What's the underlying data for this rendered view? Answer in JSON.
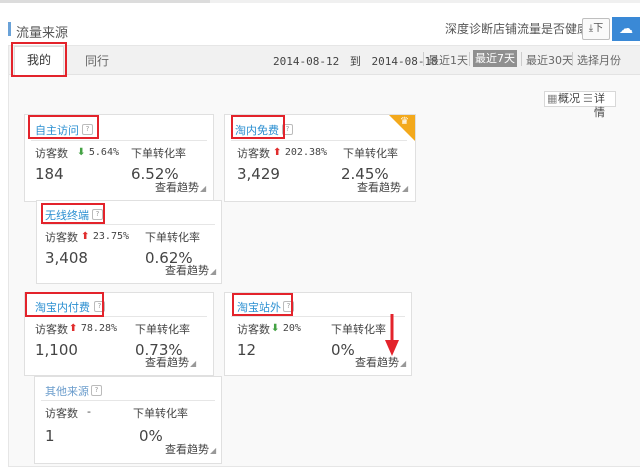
{
  "header": {
    "section_title": "流量来源",
    "health_link": "深度诊断店铺流量是否健康>>",
    "download_icon": "download-icon",
    "download_text": "下"
  },
  "tabs": [
    {
      "label": "我的",
      "active": true
    },
    {
      "label": "同行",
      "active": false
    }
  ],
  "date": {
    "from": "2014-08-12",
    "to_word": "到",
    "to": "2014-08-18"
  },
  "ranges": {
    "day1": "最近1天",
    "day7": "最近7天",
    "day30": "最近30天",
    "month": "选择月份"
  },
  "view": {
    "overview": "概况",
    "detail": "详情"
  },
  "labels": {
    "visitors": "访客数",
    "conversion": "下单转化率",
    "trend": "查看趋势",
    "help_glyph": "?"
  },
  "cards": {
    "zizhu": {
      "title": "自主访问",
      "change_dir": "down",
      "change": "5.64%",
      "visitors": "184",
      "conversion": "6.52%"
    },
    "free": {
      "title": "淘内免费",
      "change_dir": "up",
      "change": "202.38%",
      "visitors": "3,429",
      "conversion": "2.45%"
    },
    "wireless": {
      "title": "无线终端",
      "change_dir": "up",
      "change": "23.75%",
      "visitors": "3,408",
      "conversion": "0.62%"
    },
    "paid": {
      "title": "淘宝内付费",
      "change_dir": "up",
      "change": "78.28%",
      "visitors": "1,100",
      "conversion": "0.73%"
    },
    "external": {
      "title": "淘宝站外",
      "change_dir": "down",
      "change": "20%",
      "visitors": "12",
      "conversion": "0%"
    },
    "other": {
      "title": "其他来源",
      "change_dir": "none",
      "change": "-",
      "visitors": "1",
      "conversion": "0%"
    }
  },
  "colors": {
    "accent_blue": "#2b8fd1",
    "highlight_red": "#e3232b",
    "up_red": "#e02d2d",
    "down_green": "#44a244",
    "crown_orange": "#f3a91c"
  }
}
